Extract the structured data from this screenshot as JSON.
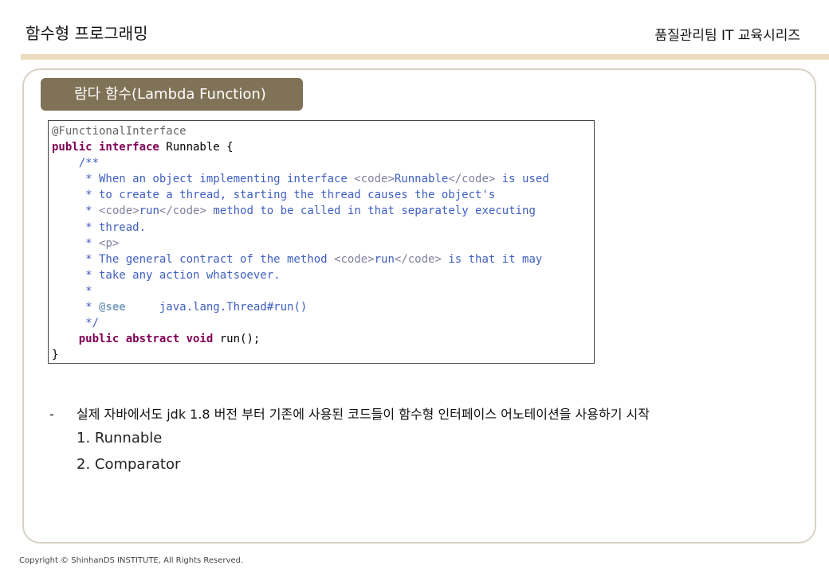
{
  "header": {
    "title": "함수형 프로그래밍",
    "series": "품질관리팀 IT 교육시리즈"
  },
  "section": {
    "title": "람다 함수(Lambda Function)"
  },
  "code": {
    "l1": "@FunctionalInterface",
    "l2_kw": "public interface",
    "l2_rest": " Runnable {",
    "l3": "    /**",
    "l4_a": "     * When an object implementing interface ",
    "l4_t1": "<code>",
    "l4_b": "Runnable",
    "l4_t2": "</code>",
    "l4_c": " is used",
    "l5": "     * to create a thread, starting the thread causes the object's",
    "l6_a": "     * ",
    "l6_t1": "<code>",
    "l6_b": "run",
    "l6_t2": "</code>",
    "l6_c": " method to be called in that separately executing",
    "l7": "     * thread.",
    "l8_a": "     * ",
    "l8_t": "<p>",
    "l9_a": "     * The general contract of the method ",
    "l9_t1": "<code>",
    "l9_b": "run",
    "l9_t2": "</code>",
    "l9_c": " is that it may",
    "l10": "     * take any action whatsoever.",
    "l11": "     *",
    "l12_a": "     * ",
    "l12_tag": "@see",
    "l12_b": "     java.lang.Thread#run()",
    "l13": "     */",
    "l14_indent": "    ",
    "l14_kw": "public abstract void",
    "l14_rest": " run();",
    "l15": "}"
  },
  "bullet": {
    "dash": "-",
    "text": "실제 자바에서도 jdk 1.8 버전 부터 기존에 사용된 코드들이 함수형 인터페이스 어노테이션을 사용하기 시작"
  },
  "list": {
    "item1": "1. Runnable",
    "item2": "2. Comparator"
  },
  "footer": {
    "copyright": "Copyright © ShinhanDS INSTITUTE, All Rights Reserved."
  },
  "colors": {
    "accent_bar": "#ecdcbf",
    "badge": "#807256",
    "keyword": "#7f0055",
    "comment": "#3f5fbf"
  }
}
